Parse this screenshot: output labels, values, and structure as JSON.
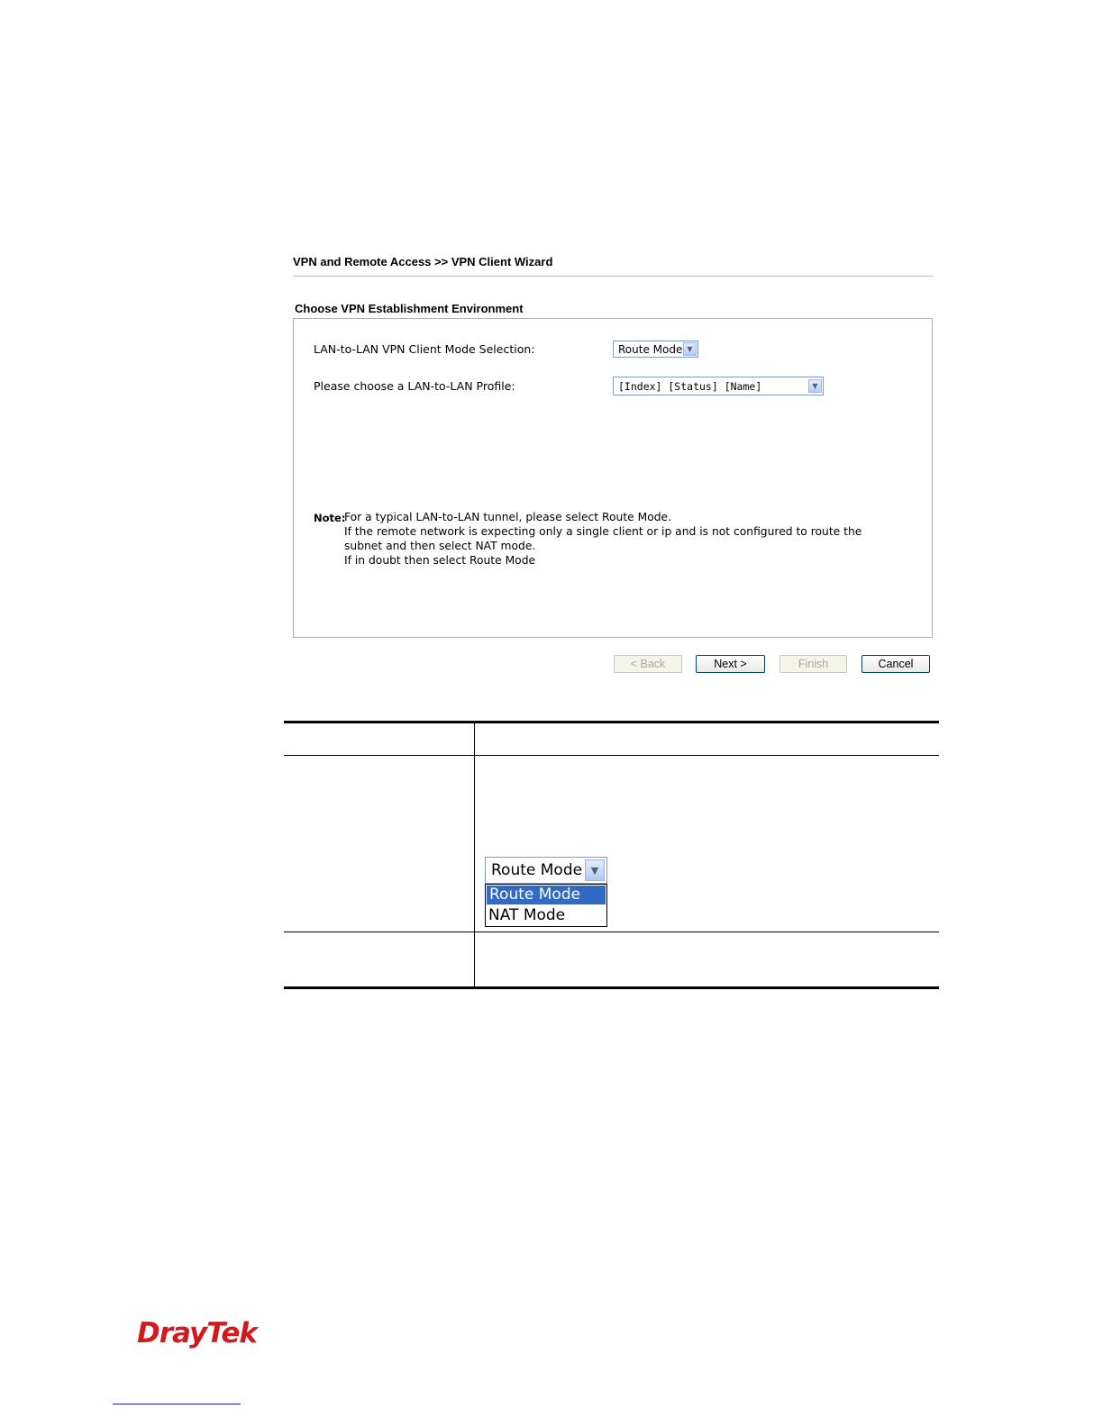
{
  "wizard": {
    "breadcrumb": "VPN and Remote Access >> VPN Client Wizard",
    "section_title": "Choose VPN Establishment Environment",
    "mode_label": "LAN-to-LAN VPN Client Mode Selection:",
    "mode_value": "Route Mode",
    "profile_label": "Please choose a LAN-to-LAN Profile:",
    "profile_value": "[Index] [Status] [Name]",
    "note_label": "Note:",
    "note_lines": [
      "For a typical LAN-to-LAN tunnel, please select Route Mode.",
      "If the remote network is expecting only a single client or ip and is not configured to route the",
      "subnet and then select NAT mode.",
      "If in doubt then select Route Mode"
    ],
    "buttons": {
      "back": "< Back",
      "next": "Next >",
      "finish": "Finish",
      "cancel": "Cancel"
    }
  },
  "dropdown_example": {
    "selected": "Route Mode",
    "options": [
      "Route Mode",
      "NAT Mode"
    ]
  },
  "logo": {
    "text": "DrayTek"
  },
  "colors": {
    "logo_red": "#d4191d",
    "selection_blue": "#316ac5",
    "button_border": "#003c74"
  }
}
